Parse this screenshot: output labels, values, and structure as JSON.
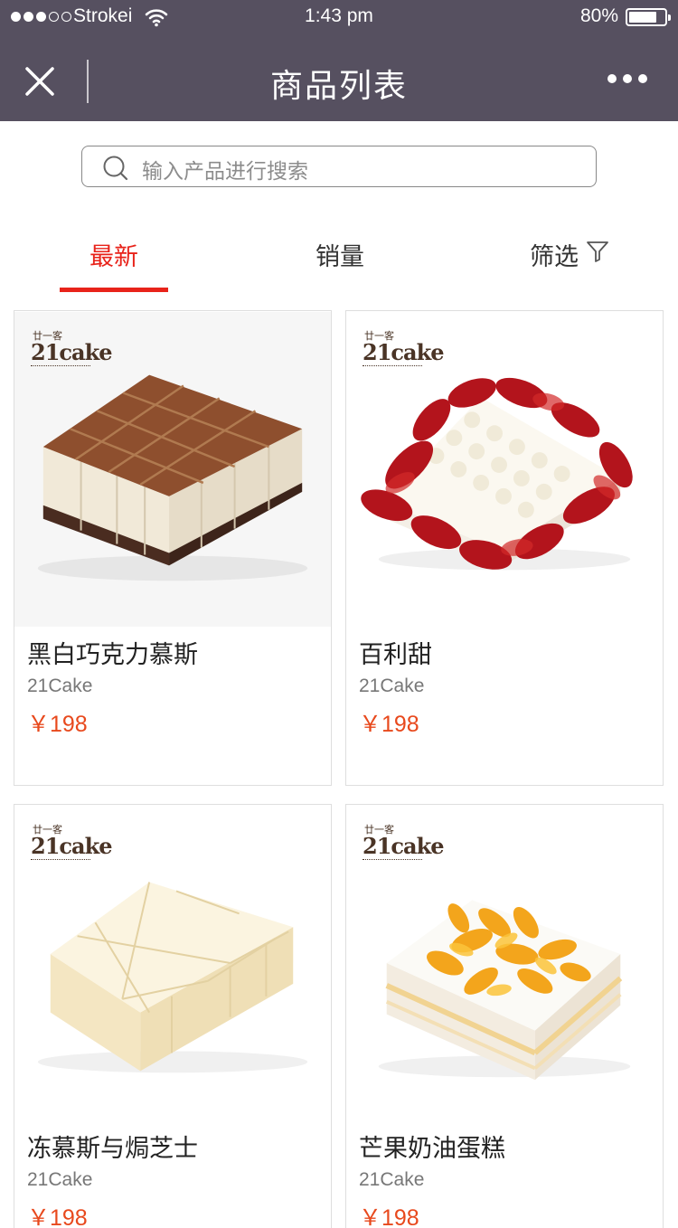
{
  "status_bar": {
    "carrier": "Strokei",
    "time": "1:43 pm",
    "battery": "80%",
    "battery_level": 0.8
  },
  "nav": {
    "title": "商品列表"
  },
  "search": {
    "placeholder": "输入产品进行搜索"
  },
  "tabs": [
    {
      "label": "最新",
      "active": true
    },
    {
      "label": "销量",
      "active": false
    },
    {
      "label": "筛选",
      "active": false
    }
  ],
  "logo": {
    "small": "廿一客",
    "big": "21cake"
  },
  "products": [
    {
      "name": "黑白巧克力慕斯",
      "brand": "21Cake",
      "price": "￥198"
    },
    {
      "name": "百利甜",
      "brand": "21Cake",
      "price": "￥198"
    },
    {
      "name": "冻慕斯与焗芝士",
      "brand": "21Cake",
      "price": "￥198"
    },
    {
      "name": "芒果奶油蛋糕",
      "brand": "21Cake",
      "price": "￥198"
    }
  ],
  "colors": {
    "topbar": "#565060",
    "accent": "#e8231a",
    "price": "#e8491d"
  }
}
